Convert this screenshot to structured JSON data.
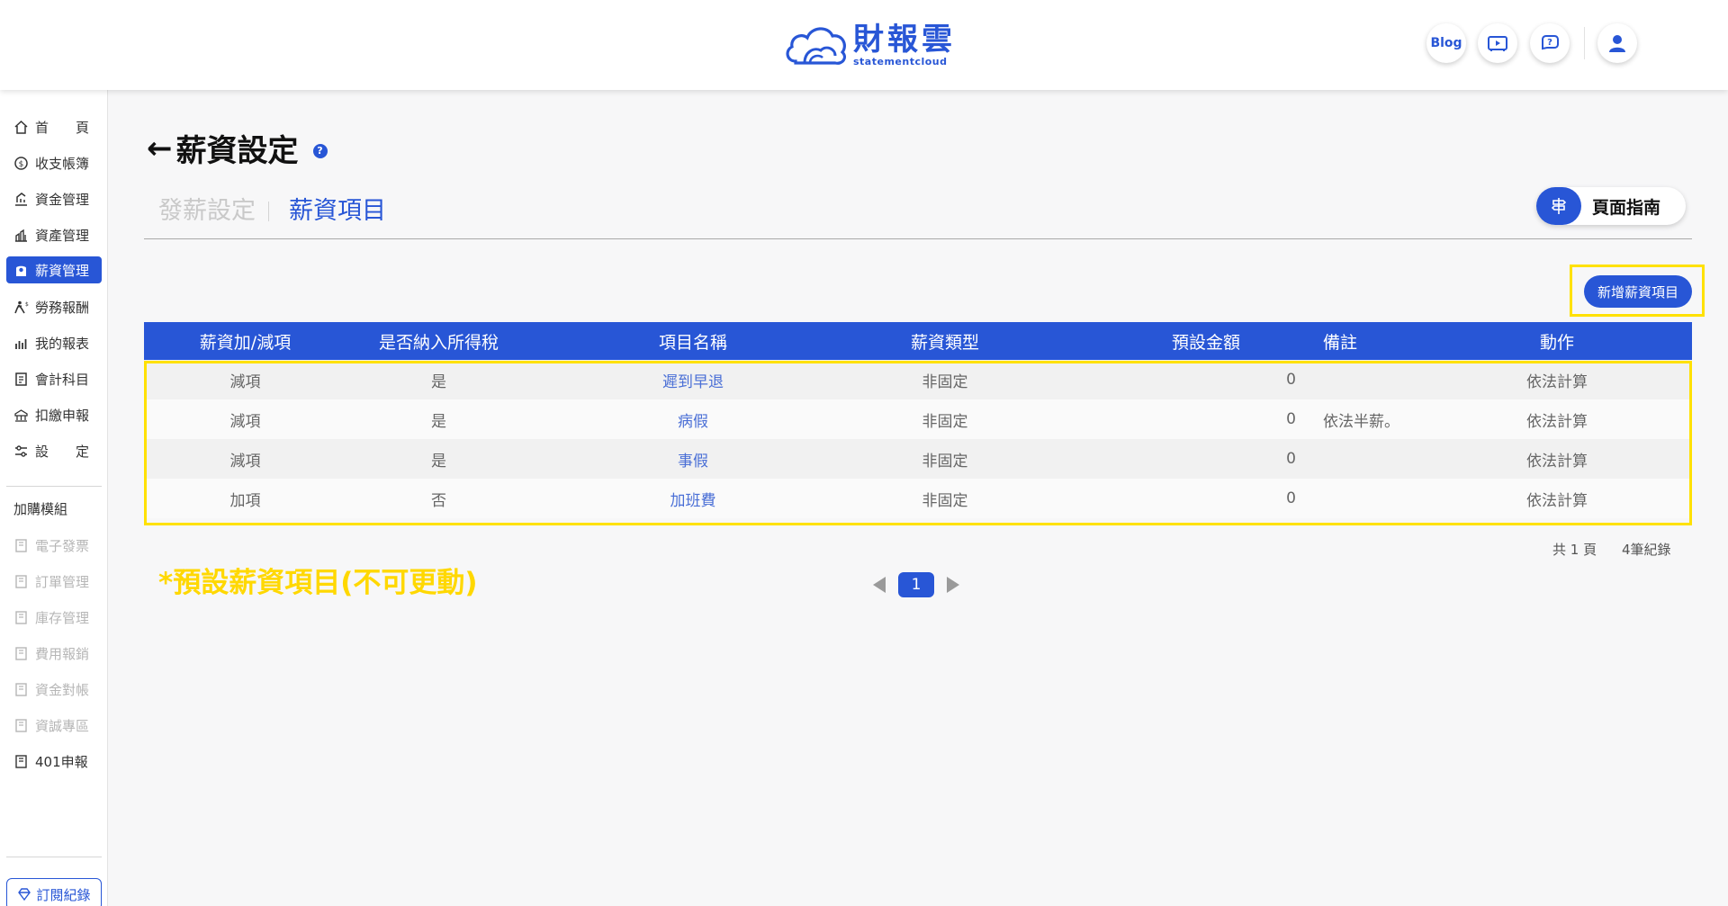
{
  "header": {
    "logo_cn": "財報雲",
    "logo_en": "statementcloud",
    "blog_label": "Blog"
  },
  "sidebar": {
    "items": [
      {
        "label": "首　　頁",
        "icon": "home-icon"
      },
      {
        "label": "收支帳簿",
        "icon": "coin-icon"
      },
      {
        "label": "資金管理",
        "icon": "fund-icon"
      },
      {
        "label": "資產管理",
        "icon": "asset-icon"
      },
      {
        "label": "薪資管理",
        "icon": "salary-icon",
        "active": true
      },
      {
        "label": "勞務報酬",
        "icon": "labor-icon"
      },
      {
        "label": "我的報表",
        "icon": "report-icon"
      },
      {
        "label": "會計科目",
        "icon": "ledger-icon"
      },
      {
        "label": "扣繳申報",
        "icon": "tax-icon"
      },
      {
        "label": "設　　定",
        "icon": "settings-icon"
      }
    ],
    "addon_title": "加購模組",
    "addons": [
      {
        "label": "電子發票",
        "enabled": false
      },
      {
        "label": "訂單管理",
        "enabled": false
      },
      {
        "label": "庫存管理",
        "enabled": false
      },
      {
        "label": "費用報銷",
        "enabled": false
      },
      {
        "label": "資金對帳",
        "enabled": false
      },
      {
        "label": "資誠專區",
        "enabled": false
      },
      {
        "label": "401申報",
        "enabled": true
      }
    ],
    "subscription_label": "訂閱紀錄"
  },
  "page": {
    "back_arrow": "←",
    "title": "薪資設定",
    "help": "?",
    "tabs": [
      {
        "label": "發薪設定",
        "active": false
      },
      {
        "label": "薪資項目",
        "active": true
      }
    ],
    "guide_label": "頁面指南",
    "add_button": "新增薪資項目"
  },
  "table": {
    "columns": [
      "薪資加/減項",
      "是否納入所得稅",
      "項目名稱",
      "薪資類型",
      "預設金額",
      "備註",
      "動作"
    ],
    "rows": [
      [
        "減項",
        "是",
        "遲到早退",
        "非固定",
        "0",
        "",
        "依法計算"
      ],
      [
        "減項",
        "是",
        "病假",
        "非固定",
        "0",
        "依法半薪。",
        "依法計算"
      ],
      [
        "減項",
        "是",
        "事假",
        "非固定",
        "0",
        "",
        "依法計算"
      ],
      [
        "加項",
        "否",
        "加班費",
        "非固定",
        "0",
        "",
        "依法計算"
      ]
    ]
  },
  "pagination": {
    "total_pages": "共 1 頁",
    "total_records": "4筆紀錄",
    "current_page": "1"
  },
  "annotation": {
    "note": "*預設薪資項目(不可更動)"
  },
  "colors": {
    "primary": "#2856d6",
    "highlight": "#ffe100"
  }
}
